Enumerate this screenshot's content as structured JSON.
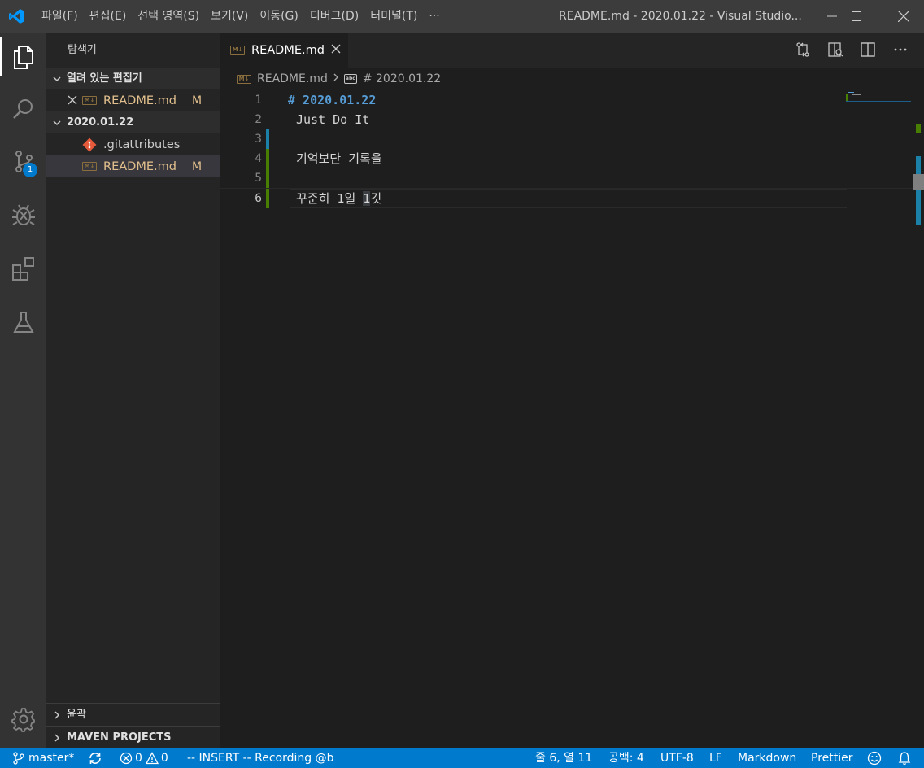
{
  "titlebar": {
    "menu": [
      "파일(F)",
      "편집(E)",
      "선택 영역(S)",
      "보기(V)",
      "이동(G)",
      "디버그(D)",
      "터미널(T)",
      "···"
    ],
    "window_title": "README.md - 2020.01.22 - Visual Studio...",
    "logo_icon": "vscode-logo-icon",
    "accent_color": "#0098ff"
  },
  "activitybar": {
    "items": [
      "explorer-icon",
      "search-icon",
      "source-control-icon",
      "debug-icon",
      "extensions-icon",
      "test-flask-icon"
    ],
    "scm_badge": "1",
    "settings_icon": "gear-icon"
  },
  "sidebar": {
    "title": "탐색기",
    "open_editors_header": "열려 있는 편집기",
    "open_editors": [
      {
        "name": "README.md",
        "flag": "M"
      }
    ],
    "folder_header": "2020.01.22",
    "files": [
      {
        "name": ".gitattributes",
        "flag": ""
      },
      {
        "name": "README.md",
        "flag": "M"
      }
    ],
    "outline_header": "윤곽",
    "maven_header": "MAVEN PROJECTS"
  },
  "editor": {
    "tab_label": "README.md",
    "breadcrumb_file": "README.md",
    "breadcrumb_symbol": "# 2020.01.22",
    "lines": [
      {
        "n": "1",
        "text": "# 2020.01.22"
      },
      {
        "n": "2",
        "text": "Just Do It"
      },
      {
        "n": "3",
        "text": ""
      },
      {
        "n": "4",
        "text": "기억보단 기록을"
      },
      {
        "n": "5",
        "text": ""
      },
      {
        "n": "6",
        "text_before": "꾸준히 1일 ",
        "text_selected": "1",
        "text_after": "깃"
      }
    ],
    "gutter_colors": {
      "modified": "#1b81a8",
      "added": "#487e02"
    }
  },
  "statusbar": {
    "branch": "master*",
    "errors": "0",
    "warnings": "0",
    "mode": "-- INSERT -- Recording @b",
    "position": "줄 6, 열 11",
    "spaces": "공백: 4",
    "encoding": "UTF-8",
    "eol": "LF",
    "language": "Markdown",
    "formatter": "Prettier"
  }
}
